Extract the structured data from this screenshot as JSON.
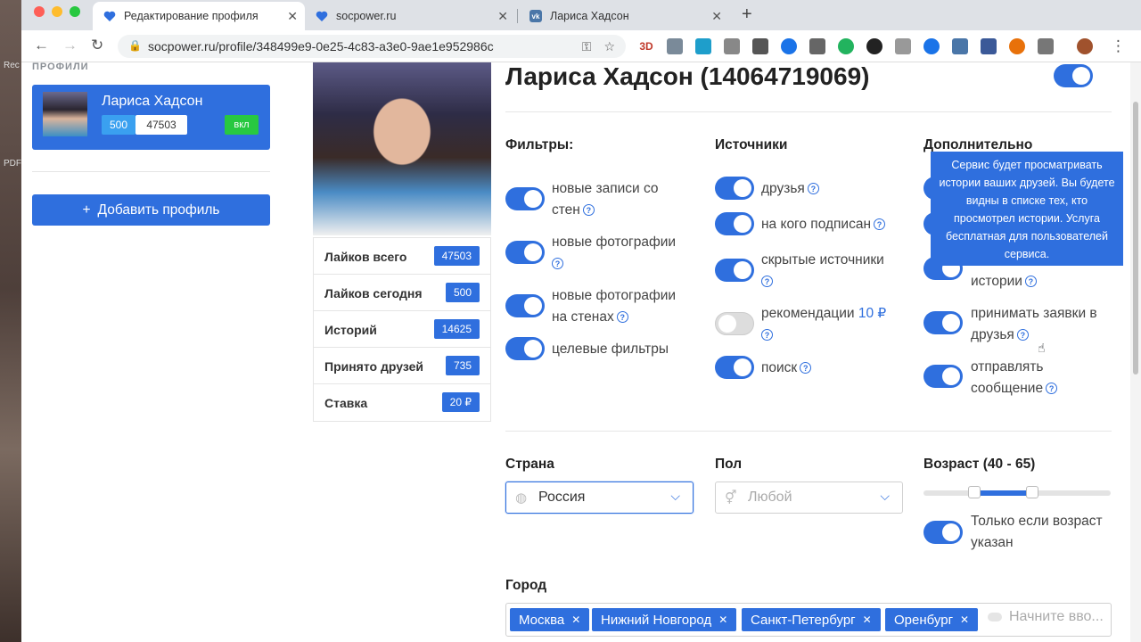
{
  "browser": {
    "tabs": [
      {
        "title": "Редактирование профиля",
        "active": true,
        "icon": "heart-icon"
      },
      {
        "title": "socpower.ru",
        "active": false,
        "icon": "heart-icon"
      },
      {
        "title": "Лариса Хадсон",
        "active": false,
        "icon": "vk-icon"
      }
    ],
    "url": "socpower.ru/profile/348499e9-0e25-4c83-a3e0-9ae1e952986c",
    "ext_3d": "3D"
  },
  "sidebar": {
    "section_label": "ПРОФИЛИ",
    "profile": {
      "name": "Лариса Хадсон",
      "likes_today": "500",
      "likes_total": "47503",
      "status": "вкл"
    },
    "add_button": "Добавить профиль"
  },
  "stats": [
    {
      "label": "Лайков всего",
      "value": "47503"
    },
    {
      "label": "Лайков сегодня",
      "value": "500"
    },
    {
      "label": "Историй",
      "value": "14625"
    },
    {
      "label": "Принято друзей",
      "value": "735"
    },
    {
      "label": "Ставка",
      "value": "20 ₽"
    }
  ],
  "main": {
    "title": "Лариса Хадсон (14064719069)",
    "filters": {
      "heading": "Фильтры:",
      "items": [
        {
          "label_l1": "новые записи со",
          "label_l2": "стен",
          "on": true
        },
        {
          "label_l1": "новые фотографии",
          "label_l2": "",
          "on": true
        },
        {
          "label_l1": "новые фотографии",
          "label_l2": "на стенах",
          "on": true
        },
        {
          "label_l1": "целевые фильтры",
          "label_l2": "",
          "on": true
        }
      ]
    },
    "sources": {
      "heading": "Источники",
      "items": [
        {
          "label": "друзья",
          "on": true
        },
        {
          "label": "на кого подписан",
          "on": true
        },
        {
          "label_l1": "скрытые источники",
          "on": true
        },
        {
          "label_l1": "рекомендации",
          "price": "10 ₽",
          "on": false
        },
        {
          "label": "поиск",
          "on": true
        }
      ]
    },
    "extra": {
      "heading": "Дополнительно",
      "items": [
        {
          "label": "истории",
          "on": true
        },
        {
          "label_l1": "принимать заявки в",
          "label_l2": "друзья",
          "on": true
        },
        {
          "label_l1": "отправлять",
          "label_l2": "сообщение",
          "on": true
        }
      ]
    },
    "tooltip": "Сервис будет просматривать истории ваших друзей. Вы будете видны в списке тех, кто просмотрел истории. Услуга бесплатная для пользователей сервиса.",
    "country": {
      "label": "Страна",
      "value": "Россия"
    },
    "gender": {
      "label": "Пол",
      "value": "Любой"
    },
    "age": {
      "label": "Возраст (40 - 65)",
      "min": 40,
      "max": 65,
      "only_if_set": "Только если возраст",
      "only_if_set_l2": "указан"
    },
    "city": {
      "label": "Город",
      "tags": [
        "Москва",
        "Нижний Новгород",
        "Санкт-Петербург",
        "Оренбург"
      ],
      "placeholder": "Начните вво..."
    }
  }
}
